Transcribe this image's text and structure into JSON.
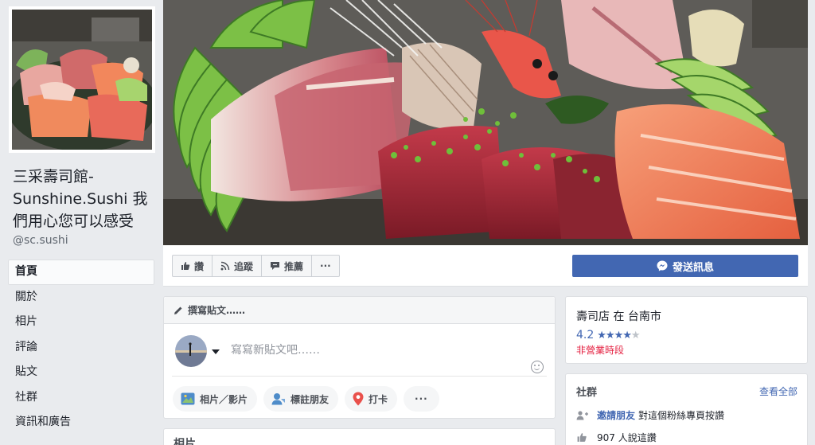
{
  "page": {
    "name": "三采壽司館-Sunshine.Sushi 我們用心您可以感受",
    "handle": "@sc.sushi"
  },
  "nav": {
    "items": [
      {
        "label": "首頁"
      },
      {
        "label": "關於"
      },
      {
        "label": "相片"
      },
      {
        "label": "評論"
      },
      {
        "label": "貼文"
      },
      {
        "label": "社群"
      },
      {
        "label": "資訊和廣告"
      }
    ]
  },
  "actions": {
    "like": "讚",
    "follow": "追蹤",
    "recommend": "推薦",
    "more": "···",
    "send_message": "發送訊息"
  },
  "composer": {
    "header": "撰寫貼文……",
    "placeholder": "寫寫新貼文吧……",
    "photo_video": "相片／影片",
    "tag_friends": "標註朋友",
    "check_in": "打卡",
    "more": "···"
  },
  "next_section": {
    "title": "相片"
  },
  "info": {
    "category": "壽司店 在 台南市",
    "rating": "4.2",
    "stars_filled": 4,
    "stars_total": 5,
    "status": "非營業時段"
  },
  "community": {
    "title": "社群",
    "see_all": "查看全部",
    "invite_link": "邀請朋友",
    "invite_text": "對這個粉絲專頁按讚",
    "likes_text": "907 人說這讚"
  },
  "colors": {
    "brand_blue": "#4267b2",
    "closed_red": "#e41e3f",
    "background": "#e9ebee"
  },
  "icons": [
    "like-icon",
    "rss-icon",
    "recommend-icon",
    "messenger-icon",
    "pencil-icon",
    "photo-icon",
    "tag-friend-icon",
    "location-pin-icon",
    "invite-icon",
    "thumb-icon"
  ]
}
